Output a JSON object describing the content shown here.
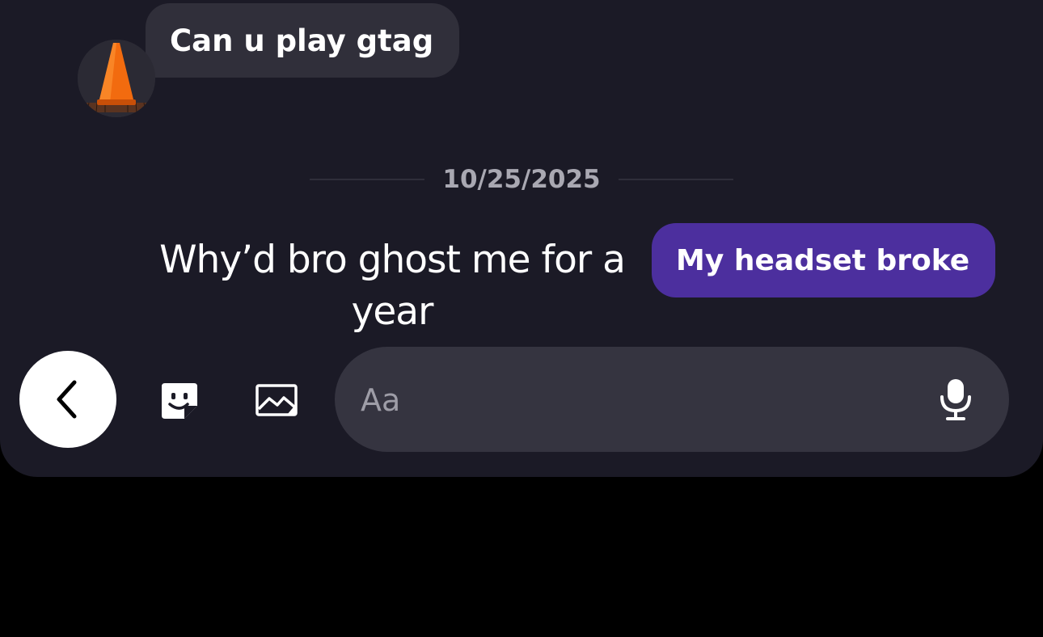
{
  "messages": {
    "incoming": {
      "text": "Can u play gtag",
      "avatar_icon": "traffic-cone-icon"
    },
    "date_divider": "10/25/2025",
    "quoted_text": "Why’d bro ghost me for a year",
    "outgoing": {
      "text": "My headset broke"
    }
  },
  "composer": {
    "placeholder": "Aa",
    "icons": {
      "back": "chevron-left-icon",
      "sticker": "sticker-icon",
      "image": "image-icon",
      "mic": "microphone-icon"
    }
  },
  "colors": {
    "panel_background": "#1b1a26",
    "incoming_bubble": "#302f3a",
    "outgoing_bubble": "#4c2f9e",
    "composer_background": "#353440"
  }
}
